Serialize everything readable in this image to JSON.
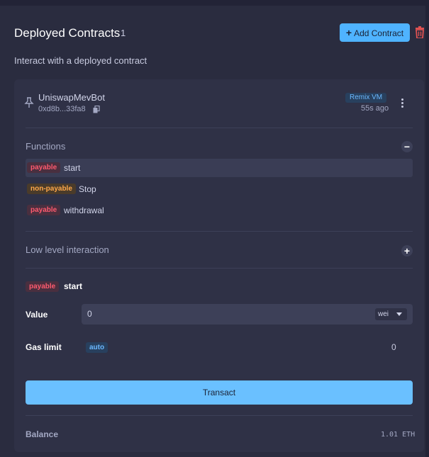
{
  "header": {
    "title": "Deployed Contracts",
    "count": "1",
    "add_label": "Add Contract",
    "subtitle": "Interact with a deployed contract"
  },
  "contract": {
    "name": "UniswapMevBot",
    "address": "0xd8b...33fa8",
    "environment": "Remix VM",
    "age": "55s ago"
  },
  "functions": {
    "label": "Functions",
    "items": [
      {
        "badge": "payable",
        "name": "start"
      },
      {
        "badge": "non-payable",
        "name": "Stop"
      },
      {
        "badge": "payable",
        "name": "withdrawal"
      }
    ]
  },
  "low_level": {
    "label": "Low level interaction"
  },
  "selected": {
    "badge": "payable",
    "name": "start",
    "value_label": "Value",
    "value": "0",
    "unit": "wei",
    "gas_label": "Gas limit",
    "gas_mode": "auto",
    "gas_value": "0",
    "transact_label": "Transact"
  },
  "balance": {
    "label": "Balance",
    "value": "1.01 ETH"
  },
  "colors": {
    "accent": "#4fb3ff",
    "payable": "#ff5a6e",
    "non_payable": "#ffa84a",
    "delete": "#e05252"
  }
}
